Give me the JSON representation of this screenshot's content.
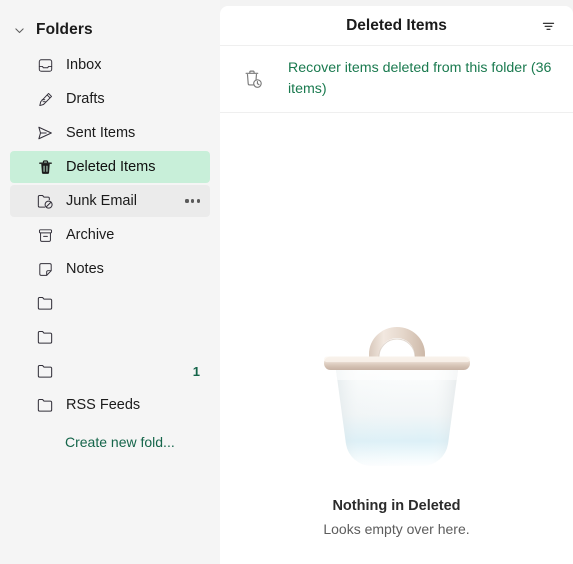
{
  "sidebar": {
    "header": {
      "label": "Folders",
      "chevron_icon": "chevron-down-icon"
    },
    "items": [
      {
        "label": "Inbox",
        "icon": "inbox-icon",
        "state": "normal",
        "count": "",
        "more": false
      },
      {
        "label": "Drafts",
        "icon": "drafts-pencil-icon",
        "state": "normal",
        "count": "",
        "more": false
      },
      {
        "label": "Sent Items",
        "icon": "send-icon",
        "state": "normal",
        "count": "",
        "more": false
      },
      {
        "label": "Deleted Items",
        "icon": "trash-icon",
        "state": "selected",
        "count": "",
        "more": false
      },
      {
        "label": "Junk Email",
        "icon": "junk-folder-icon",
        "state": "hovered",
        "count": "",
        "more": true
      },
      {
        "label": "Archive",
        "icon": "archive-icon",
        "state": "normal",
        "count": "",
        "more": false
      },
      {
        "label": "Notes",
        "icon": "notes-icon",
        "state": "normal",
        "count": "",
        "more": false
      },
      {
        "label": "",
        "icon": "folder-icon",
        "state": "normal",
        "count": "",
        "more": false
      },
      {
        "label": "",
        "icon": "folder-icon",
        "state": "normal",
        "count": "",
        "more": false
      },
      {
        "label": "",
        "icon": "folder-icon",
        "state": "normal",
        "count": "1",
        "more": false
      },
      {
        "label": "RSS Feeds",
        "icon": "folder-icon",
        "state": "normal",
        "count": "",
        "more": false
      }
    ],
    "create_new_folder": "Create new fold..."
  },
  "main": {
    "title": "Deleted Items",
    "filter_icon": "filter-icon",
    "recover": {
      "icon": "trash-restore-icon",
      "text": "Recover items deleted from this folder (36 items)"
    },
    "empty_state": {
      "illustration": "trash-bin-illustration",
      "title": "Nothing in Deleted",
      "subtitle": "Looks empty over here."
    }
  },
  "colors": {
    "selected_row": "#c8efd9",
    "hover_row": "#ebebeb",
    "link_green": "#1a7a4f",
    "badge_green": "#15654a",
    "sidebar_bg": "#f5f5f5",
    "panel_bg": "#ffffff"
  }
}
